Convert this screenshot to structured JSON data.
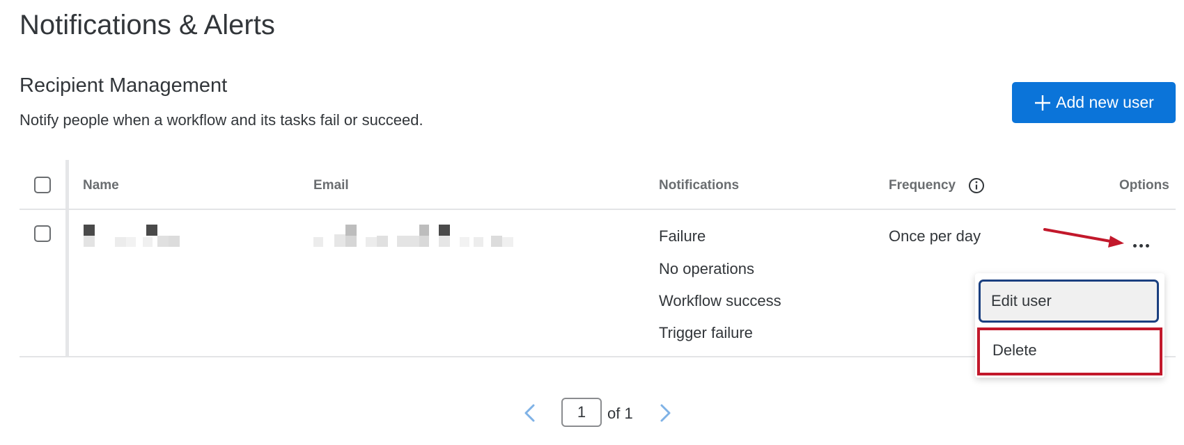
{
  "page": {
    "title": "Notifications & Alerts"
  },
  "section": {
    "title": "Recipient Management",
    "description": "Notify people when a workflow and its tasks fail or succeed.",
    "add_button_label": "Add new user"
  },
  "table": {
    "columns": {
      "name": "Name",
      "email": "Email",
      "notifications": "Notifications",
      "frequency": "Frequency",
      "options": "Options"
    },
    "rows": [
      {
        "notifications": [
          "Failure",
          "No operations",
          "Workflow success",
          "Trigger failure"
        ],
        "frequency": "Once per day"
      }
    ]
  },
  "options_menu": {
    "edit_label": "Edit user",
    "delete_label": "Delete"
  },
  "pagination": {
    "current": "1",
    "of_label": "of 1"
  },
  "colors": {
    "primary_button": "#0b74d9",
    "highlight_red": "#c2182b",
    "focus_blue": "#1a3f80"
  },
  "icons": {
    "add": "plus-icon",
    "info": "info-icon",
    "options": "more-horizontal-icon",
    "annotation": "red-arrow-icon",
    "prev": "chevron-left-icon",
    "next": "chevron-right-icon"
  }
}
